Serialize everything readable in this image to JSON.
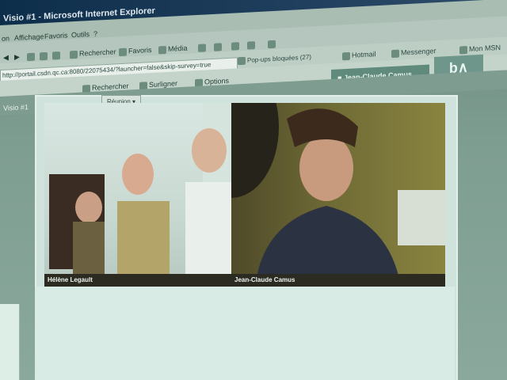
{
  "window": {
    "title": "Visio #1 - Microsoft Internet Explorer"
  },
  "menu": [
    "on",
    "Affichage",
    "Favoris",
    "Outils",
    "?"
  ],
  "toolbar": {
    "rechercher": "Rechercher",
    "favoris": "Favoris",
    "media": "Média"
  },
  "address": {
    "url": "http://portail.csdn.qc.ca:8080/22075434/?launcher=false&skip-survey=true"
  },
  "links": {
    "popups": "Pop-ups bloquées (27)",
    "hotmail": "Hotmail",
    "messenger": "Messenger",
    "mon_msn": "Mon MSN",
    "rechercher2": "Rechercher",
    "surligner": "Surligner",
    "options": "Options"
  },
  "user": {
    "name": "Jean-Claude Camus"
  },
  "logo": {
    "text": "b∧"
  },
  "page": {
    "title": "Visio #1",
    "reunion_label": "Réunion"
  },
  "videos": [
    {
      "caption": "Hélène Legault"
    },
    {
      "caption": "Jean-Claude Camus"
    }
  ]
}
